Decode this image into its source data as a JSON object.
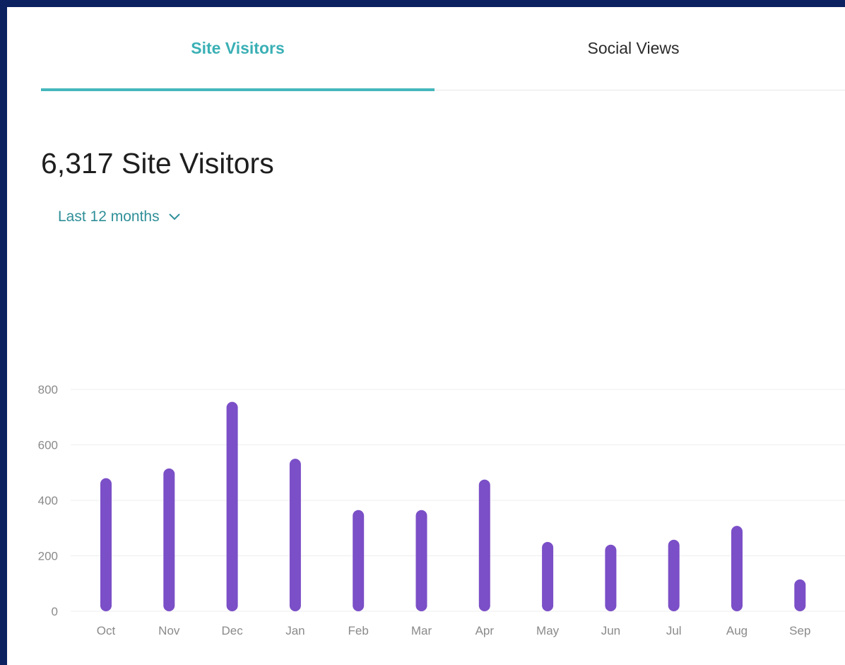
{
  "tabs": {
    "site_visitors": "Site Visitors",
    "social_views": "Social Views"
  },
  "headline": "6,317 Site Visitors",
  "range_selector": {
    "label": "Last 12 months",
    "icon": "chevron-down-icon"
  },
  "colors": {
    "background": "#0b2160",
    "accent": "#45b7bc",
    "bar": "#7b4fc7"
  },
  "chart_data": {
    "type": "bar",
    "categories": [
      "Oct",
      "Nov",
      "Dec",
      "Jan",
      "Feb",
      "Mar",
      "Apr",
      "May",
      "Jun",
      "Jul",
      "Aug",
      "Sep"
    ],
    "values": [
      480,
      515,
      755,
      550,
      365,
      365,
      475,
      250,
      240,
      258,
      308,
      115
    ],
    "yticks": [
      0,
      200,
      400,
      600,
      800
    ],
    "ylim": [
      0,
      800
    ],
    "grid": true
  }
}
